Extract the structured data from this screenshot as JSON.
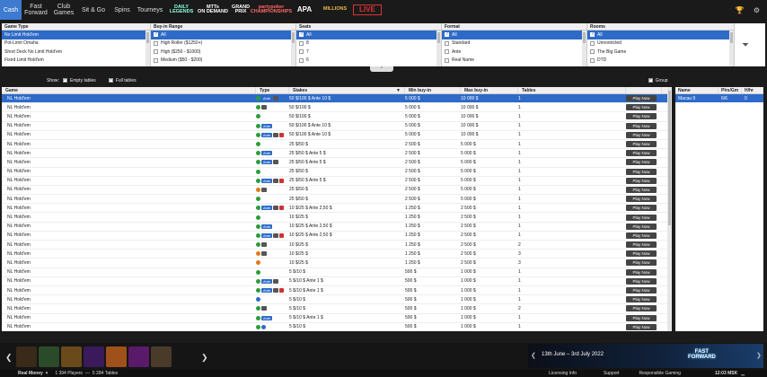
{
  "nav": {
    "tabs": [
      "Cash",
      "Fast\nForward",
      "Club\nGames",
      "Sit & Go",
      "Spins",
      "Tourneys"
    ],
    "active": 0,
    "logos": [
      "DAILY\nLEGENDS",
      "MTTs\nON DEMAND",
      "GRAND\nPRIX",
      "partypoker\nCHAMPIONSHIPS",
      "APA",
      "MILLIONS",
      "LIVE"
    ]
  },
  "filters": {
    "game_type": {
      "header": "Game Type",
      "items": [
        "No Limit Hold'em",
        "Pot-Limit Omaha",
        "Short Deck No Limit Hold'em",
        "Fixed Limit Hold'em"
      ]
    },
    "buy_in": {
      "header": "Buy-in Range",
      "items": [
        "All",
        "High Roller ($1250+)",
        "High ($250 - $1000)",
        "Medium ($50 - $200)"
      ]
    },
    "seats": {
      "header": "Seats",
      "items": [
        "All",
        "8",
        "7",
        "6"
      ]
    },
    "format": {
      "header": "Format",
      "items": [
        "All",
        "Standard",
        "Ante",
        "Real Name"
      ]
    },
    "rooms": {
      "header": "Rooms",
      "items": [
        "All",
        "Unrestricted",
        "The Big Game",
        "DTD"
      ]
    }
  },
  "options": {
    "show_label": "Show:",
    "empty_tables": "Empty tables",
    "full_tables": "Full tables",
    "group": "Group"
  },
  "table": {
    "headers": [
      "Game",
      "Type",
      "Stakes",
      "Min buy-in",
      "Max buy-in",
      "Tables"
    ],
    "play_label": "Play Now",
    "rows": [
      {
        "game": "NL Hold'em",
        "type": "g,ante,x",
        "stakes": "50 $/100 $ Ante 10 $",
        "min": "5 000 $",
        "max": "10 000 $",
        "tables": "1"
      },
      {
        "game": "NL Hold'em",
        "type": "g,x",
        "stakes": "50 $/100 $",
        "min": "5 000 $",
        "max": "10 000 $",
        "tables": "1"
      },
      {
        "game": "NL Hold'em",
        "type": "g",
        "stakes": "50 $/100 $",
        "min": "5 000 $",
        "max": "10 000 $",
        "tables": "1"
      },
      {
        "game": "NL Hold'em",
        "type": "g,ante",
        "stakes": "50 $/100 $ Ante 10 $",
        "min": "5 000 $",
        "max": "10 000 $",
        "tables": "1"
      },
      {
        "game": "NL Hold'em",
        "type": "g,ante,x,r",
        "stakes": "50 $/100 $ Ante 10 $",
        "min": "5 000 $",
        "max": "10 000 $",
        "tables": "1"
      },
      {
        "game": "NL Hold'em",
        "type": "g",
        "stakes": "25 $/50 $",
        "min": "2 500 $",
        "max": "5 000 $",
        "tables": "1"
      },
      {
        "game": "NL Hold'em",
        "type": "g,ante",
        "stakes": "25 $/50 $ Ante 5 $",
        "min": "2 500 $",
        "max": "5 000 $",
        "tables": "1"
      },
      {
        "game": "NL Hold'em",
        "type": "g,ante,x",
        "stakes": "25 $/50 $ Ante 5 $",
        "min": "2 500 $",
        "max": "5 000 $",
        "tables": "1"
      },
      {
        "game": "NL Hold'em",
        "type": "g",
        "stakes": "25 $/50 $",
        "min": "2 500 $",
        "max": "5 000 $",
        "tables": "1"
      },
      {
        "game": "NL Hold'em",
        "type": "g,ante,x,r",
        "stakes": "25 $/50 $ Ante 5 $",
        "min": "2 500 $",
        "max": "5 000 $",
        "tables": "1"
      },
      {
        "game": "NL Hold'em",
        "type": "o,x",
        "stakes": "25 $/50 $",
        "min": "2 500 $",
        "max": "5 000 $",
        "tables": "1"
      },
      {
        "game": "NL Hold'em",
        "type": "g",
        "stakes": "25 $/50 $",
        "min": "2 500 $",
        "max": "5 000 $",
        "tables": "1"
      },
      {
        "game": "NL Hold'em",
        "type": "g,ante,x,r",
        "stakes": "10 $/25 $ Ante 2,50 $",
        "min": "1 250 $",
        "max": "2 500 $",
        "tables": "1"
      },
      {
        "game": "NL Hold'em",
        "type": "g",
        "stakes": "10 $/25 $",
        "min": "1 250 $",
        "max": "2 500 $",
        "tables": "1"
      },
      {
        "game": "NL Hold'em",
        "type": "g,ante",
        "stakes": "10 $/25 $ Ante 2,50 $",
        "min": "1 250 $",
        "max": "2 500 $",
        "tables": "1"
      },
      {
        "game": "NL Hold'em",
        "type": "g,ante,x,r",
        "stakes": "10 $/25 $ Ante 2,50 $",
        "min": "1 250 $",
        "max": "2 500 $",
        "tables": "1"
      },
      {
        "game": "NL Hold'em",
        "type": "g,x",
        "stakes": "10 $/25 $",
        "min": "1 250 $",
        "max": "2 500 $",
        "tables": "2"
      },
      {
        "game": "NL Hold'em",
        "type": "o,x",
        "stakes": "10 $/25 $",
        "min": "1 250 $",
        "max": "2 500 $",
        "tables": "3"
      },
      {
        "game": "NL Hold'em",
        "type": "o",
        "stakes": "10 $/25 $",
        "min": "1 250 $",
        "max": "2 500 $",
        "tables": "3"
      },
      {
        "game": "NL Hold'em",
        "type": "g",
        "stakes": "5 $/10 $",
        "min": "500 $",
        "max": "1 000 $",
        "tables": "1"
      },
      {
        "game": "NL Hold'em",
        "type": "g,ante,x",
        "stakes": "5 $/10 $ Ante 1 $",
        "min": "500 $",
        "max": "1 000 $",
        "tables": "1"
      },
      {
        "game": "NL Hold'em",
        "type": "g,ante,x,r",
        "stakes": "5 $/10 $ Ante 1 $",
        "min": "500 $",
        "max": "1 000 $",
        "tables": "1"
      },
      {
        "game": "NL Hold'em",
        "type": "b",
        "stakes": "5 $/10 $",
        "min": "500 $",
        "max": "1 000 $",
        "tables": "1"
      },
      {
        "game": "NL Hold'em",
        "type": "g,x",
        "stakes": "5 $/10 $",
        "min": "500 $",
        "max": "1 000 $",
        "tables": "2"
      },
      {
        "game": "NL Hold'em",
        "type": "g,ante",
        "stakes": "5 $/10 $ Ante 1 $",
        "min": "500 $",
        "max": "1 000 $",
        "tables": "1"
      },
      {
        "game": "NL Hold'em",
        "type": "g,b",
        "stakes": "5 $/10 $",
        "min": "500 $",
        "max": "1 000 $",
        "tables": "1"
      }
    ]
  },
  "side": {
    "headers": [
      "Name",
      "Plrs/Gm",
      "H/hr"
    ],
    "row": {
      "name": "Macau 9",
      "plrs": "6/6",
      "hhr": "0"
    }
  },
  "banner": {
    "text": "13th June – 3rd July 2022",
    "brand": "FAST\nFORWARD"
  },
  "status": {
    "mode": "Real Money",
    "players": "1 394 Players",
    "tables": "5 284 Tables",
    "links": [
      "Licensing Info",
      "Support",
      "Responsible Gaming"
    ],
    "time": "12:03 MSK"
  }
}
